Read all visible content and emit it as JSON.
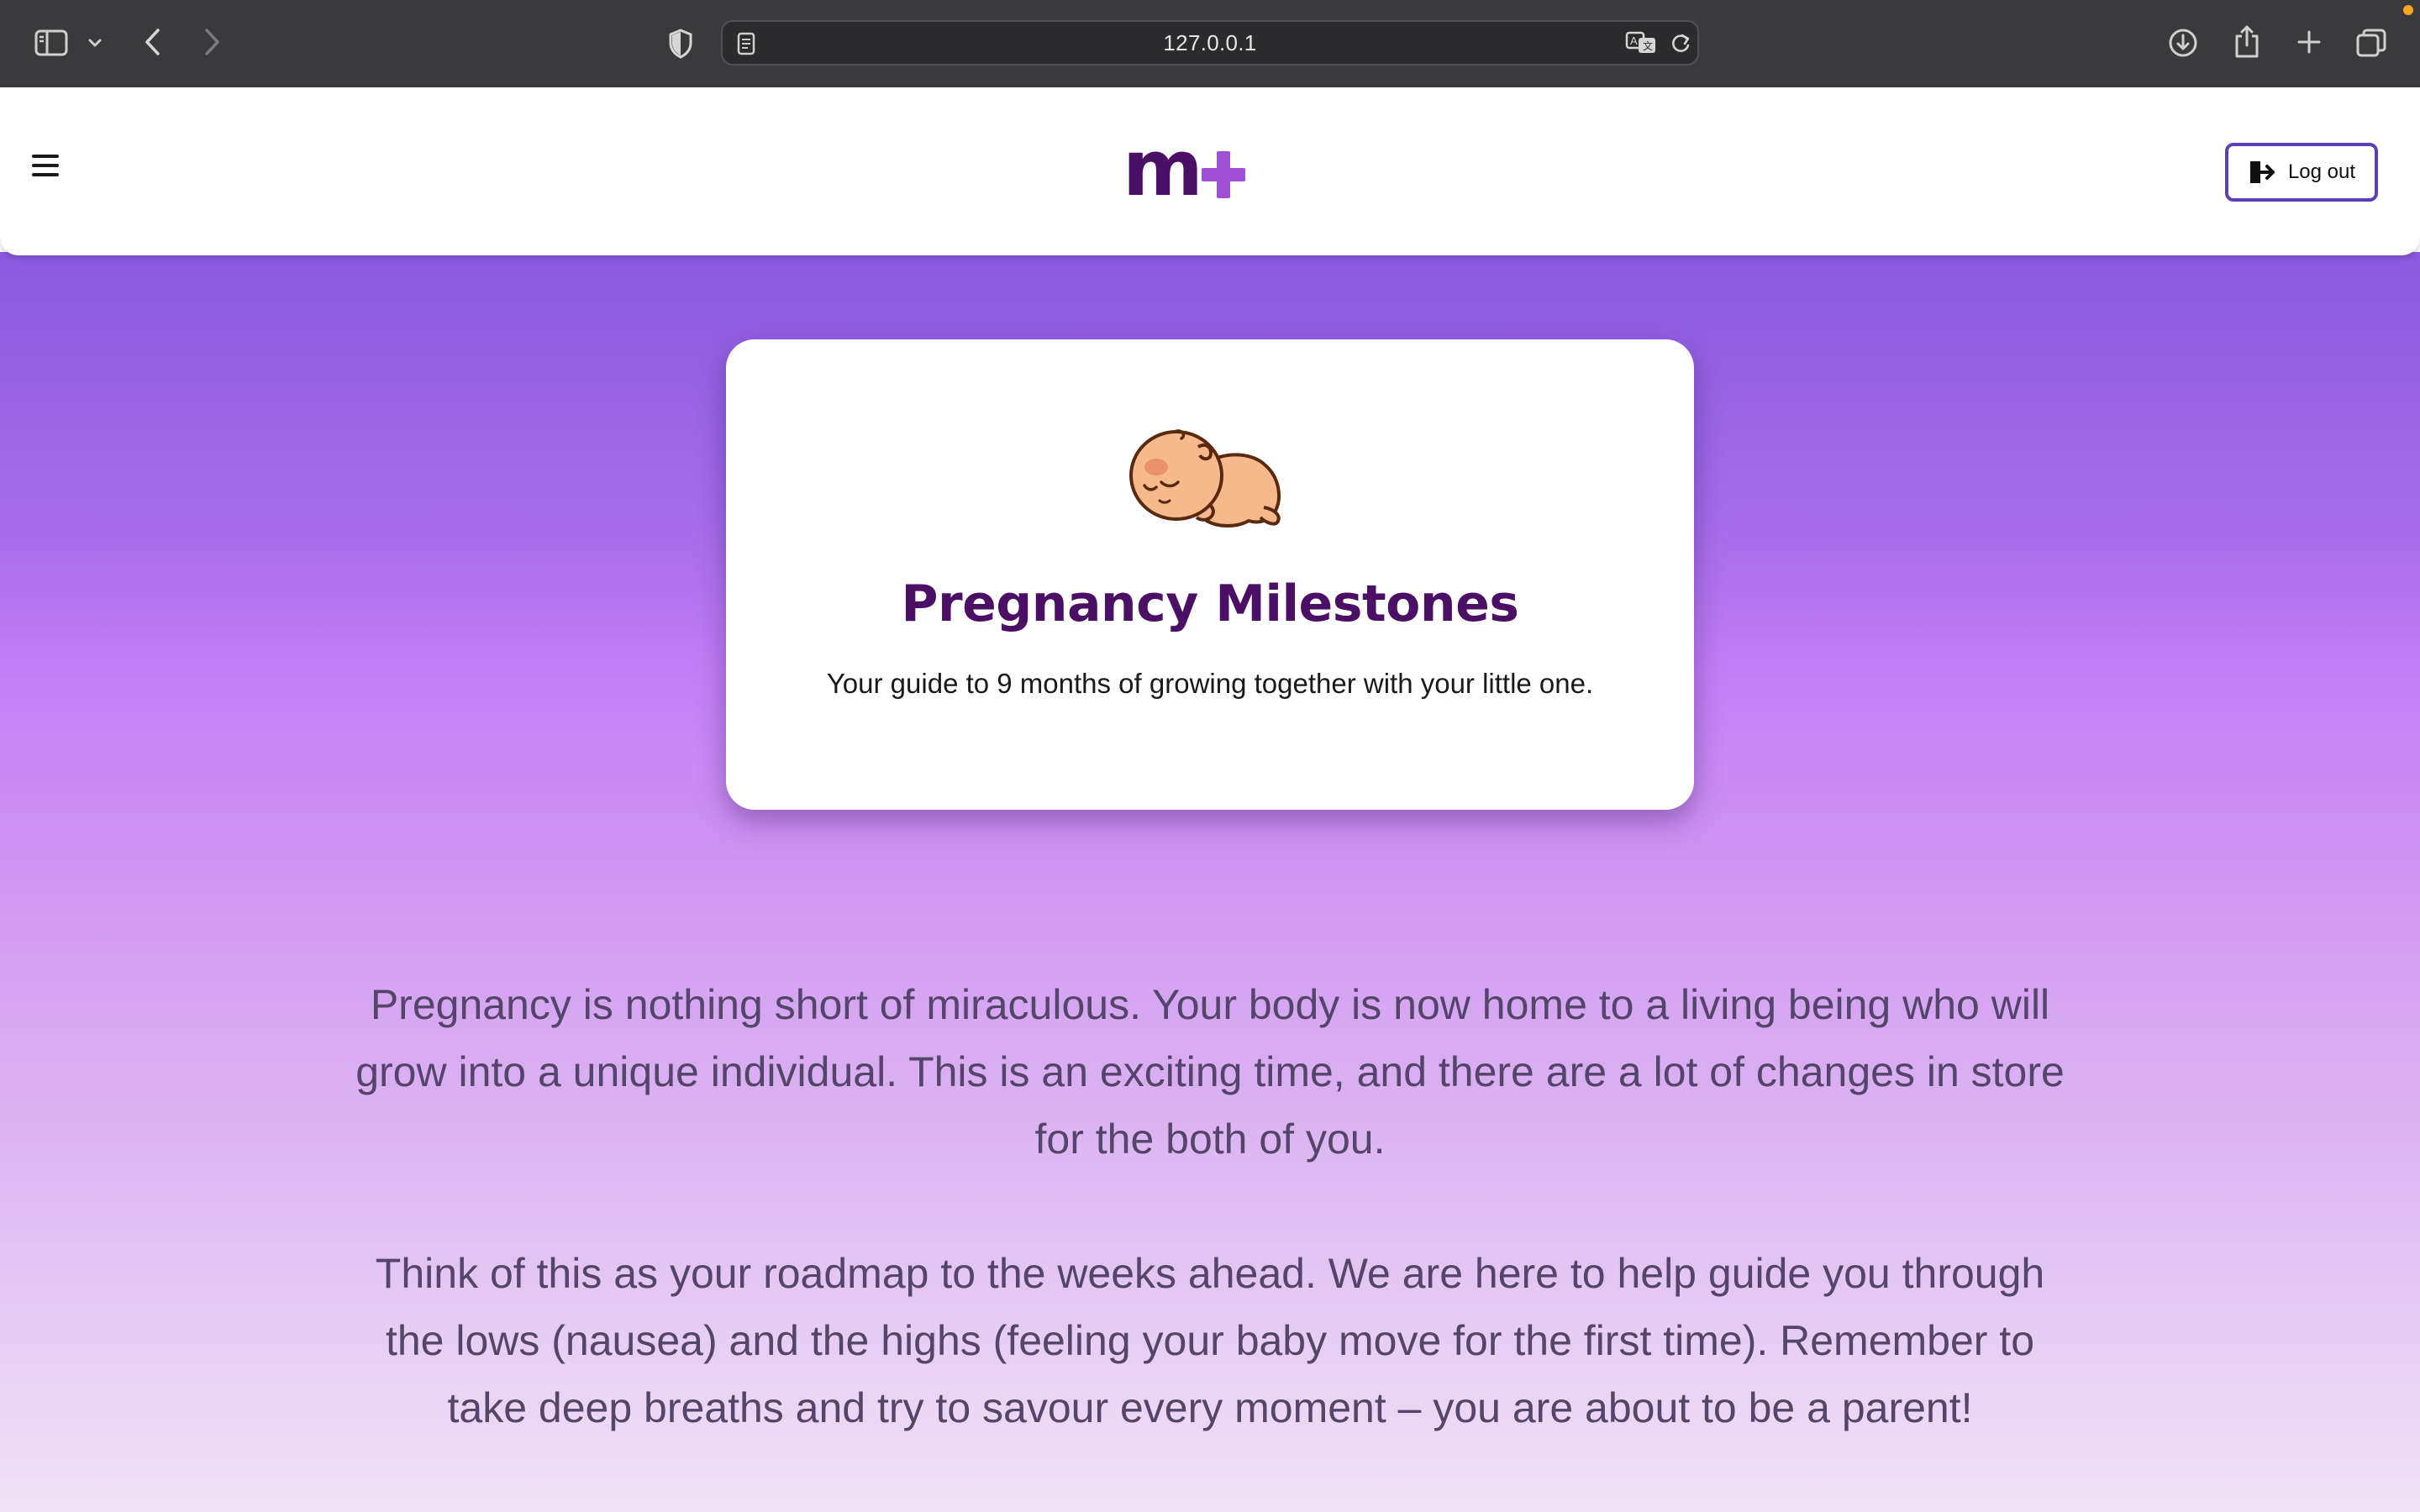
{
  "browser": {
    "url": "127.0.0.1",
    "icons": [
      "sidebar-icon",
      "chevron-down-icon",
      "back-icon",
      "forward-icon",
      "privacy-shield-icon",
      "reader-icon",
      "translate-icon",
      "reload-icon",
      "download-icon",
      "share-icon",
      "new-tab-icon",
      "tabs-overview-icon"
    ]
  },
  "header": {
    "menu_icon": "hamburger-menu-icon",
    "logo_icon": "m-plus-logo",
    "logout_label": "Log out",
    "logout_icon": "logout-icon",
    "colors": {
      "logo_primary": "#4b1066",
      "logo_accent": "#a14fd6",
      "button_border": "#5b3fb6"
    }
  },
  "hero": {
    "image_icon": "sleeping-baby-icon",
    "title": "Pregnancy Milestones",
    "subtitle": "Your guide to 9 months of growing together with your little one."
  },
  "intro": {
    "paragraph1": "Pregnancy is nothing short of miraculous. Your body is now home to a living being who will grow into a unique individual. This is an exciting time, and there are a lot of changes in store for the both of you.",
    "paragraph2": "Think of this as your roadmap to the weeks ahead. We are here to help guide you through the lows (nausea) and the highs (feeling your baby move for the first time). Remember to take deep breaths and try to savour every moment – you are about to be a parent!"
  },
  "theme": {
    "gradient_top": "#8a5ae2",
    "gradient_mid": "#c17ef4",
    "gradient_bottom": "#f1e3f6",
    "title_color": "#4b1066",
    "body_text": "#54456a"
  }
}
